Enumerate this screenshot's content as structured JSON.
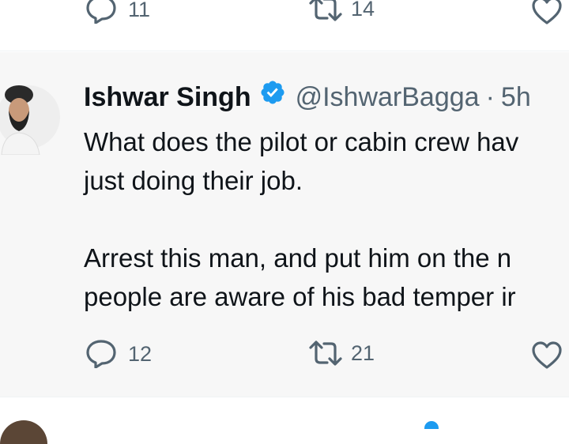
{
  "previous_tweet": {
    "reply_count": "11",
    "retweet_count": "14",
    "icons": {
      "reply": "reply-icon",
      "retweet": "retweet-icon",
      "like": "heart-icon"
    }
  },
  "tweet": {
    "author_name": "Ishwar Singh",
    "verified": true,
    "handle": "@IshwarBagga",
    "separator": "·",
    "time": "5h",
    "lines": [
      "What does the pilot or cabin crew hav",
      "just doing their job.",
      "Arrest this man, and put him on the n",
      "people are aware of his bad temper ir"
    ],
    "reply_count": "12",
    "retweet_count": "21",
    "icons": {
      "reply": "reply-icon",
      "retweet": "retweet-icon",
      "like": "heart-icon",
      "verified": "verified-badge-icon"
    }
  },
  "colors": {
    "text_primary": "#0f1419",
    "text_secondary": "#536471",
    "verified_blue": "#1d9bf0",
    "highlight_bg": "#f7f7f7"
  }
}
